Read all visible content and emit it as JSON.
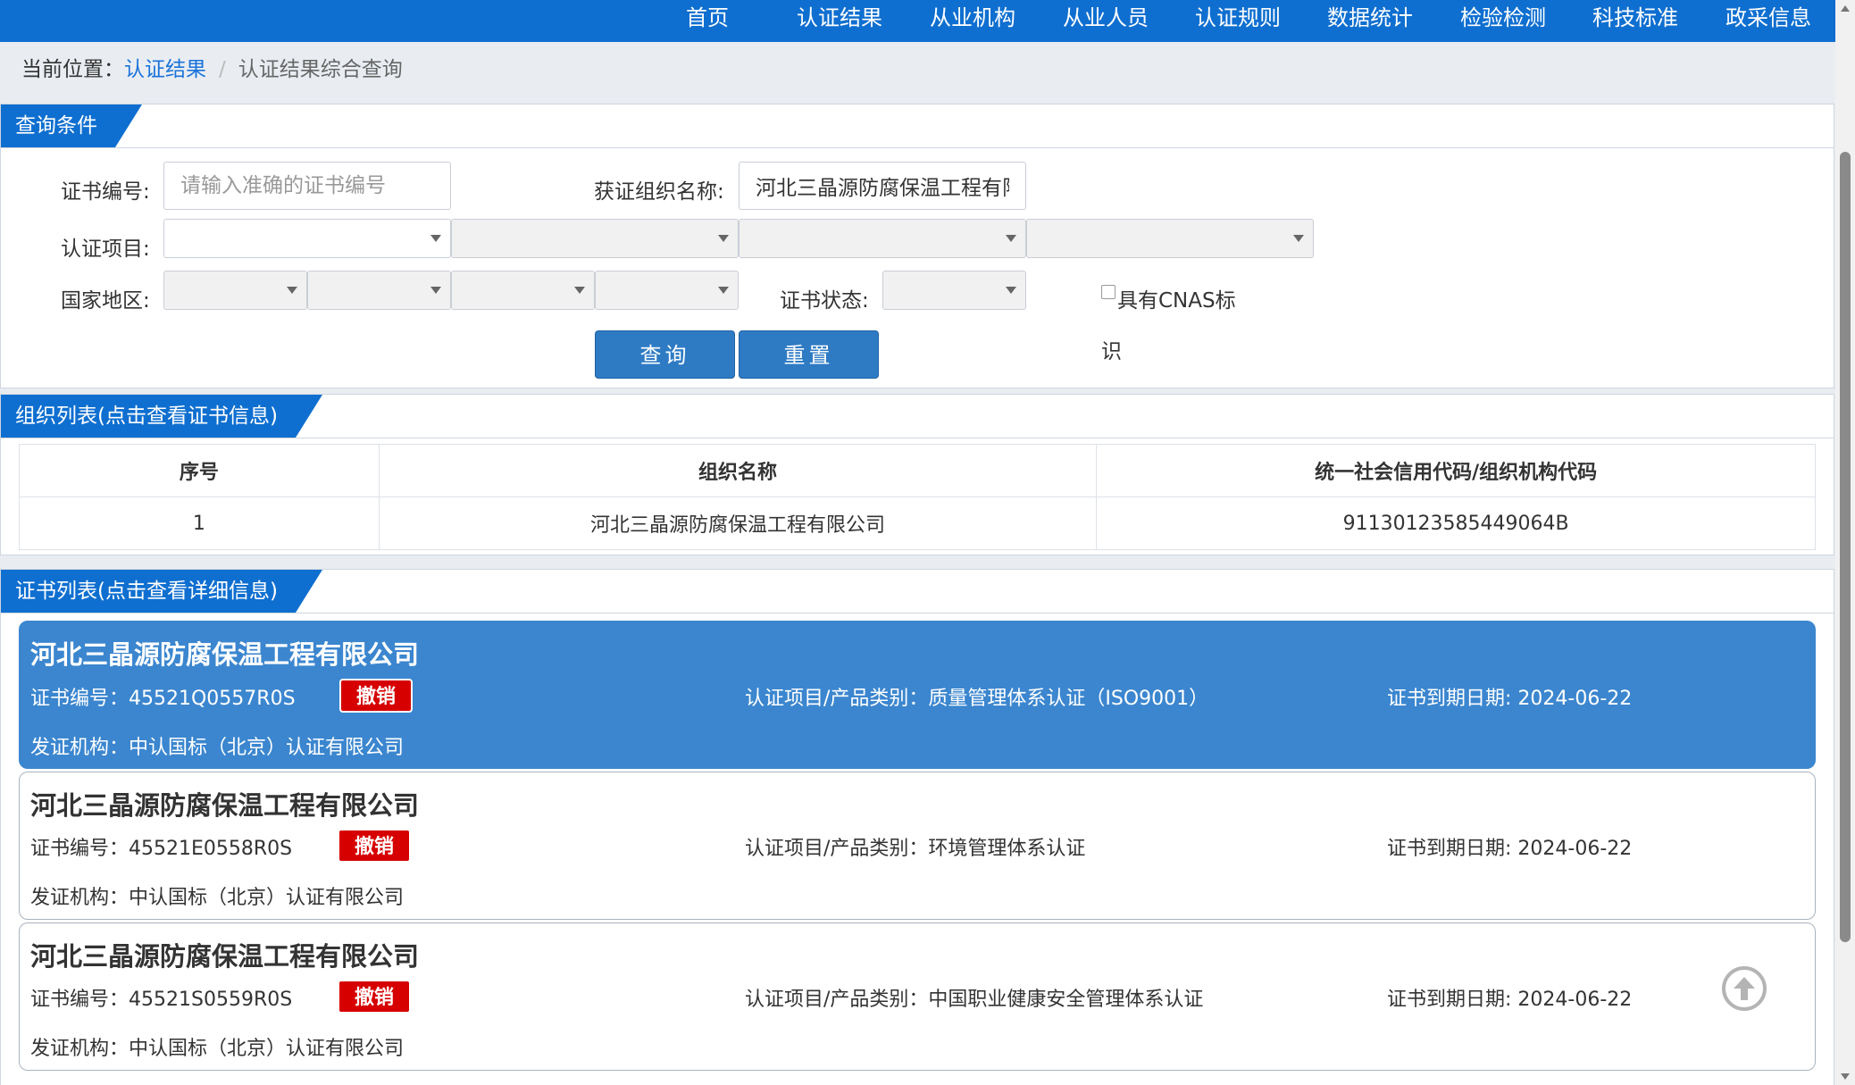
{
  "nav": {
    "items": [
      "首页",
      "认证结果",
      "从业机构",
      "从业人员",
      "认证规则",
      "数据统计",
      "检验检测",
      "科技标准",
      "政采信息"
    ]
  },
  "breadcrumb": {
    "prefix": "当前位置：",
    "link": "认证结果",
    "separator": "/",
    "current": "认证结果综合查询"
  },
  "query": {
    "title": "查询条件",
    "cert_no_label": "证书编号:",
    "cert_no_placeholder": "请输入准确的证书编号",
    "cert_no_value": "",
    "org_name_label": "获证组织名称:",
    "org_name_value": "河北三晶源防腐保温工程有限公司",
    "project_label": "认证项目:",
    "region_label": "国家地区:",
    "status_label": "证书状态:",
    "cnas_label": "具有CNAS标",
    "cnas_label_wrap": "识",
    "search_button": "查询",
    "reset_button": "重置"
  },
  "org_list": {
    "title": "组织列表(点击查看证书信息)",
    "columns": [
      "序号",
      "组织名称",
      "统一社会信用代码/组织机构代码"
    ],
    "rows": [
      {
        "index": "1",
        "name": "河北三晶源防腐保温工程有限公司",
        "code": "91130123585449064B"
      }
    ]
  },
  "cert_list": {
    "title": "证书列表(点击查看详细信息)",
    "cards": [
      {
        "org": "河北三晶源防腐保温工程有限公司",
        "cert_no": "证书编号：45521Q0557R0S",
        "status": "撤销",
        "category": "认证项目/产品类别：质量管理体系认证（ISO9001）",
        "expiry": "证书到期日期: 2024-06-22",
        "issuer": "发证机构：中认国标（北京）认证有限公司"
      },
      {
        "org": "河北三晶源防腐保温工程有限公司",
        "cert_no": "证书编号：45521E0558R0S",
        "status": "撤销",
        "category": "认证项目/产品类别：环境管理体系认证",
        "expiry": "证书到期日期: 2024-06-22",
        "issuer": "发证机构：中认国标（北京）认证有限公司"
      },
      {
        "org": "河北三晶源防腐保温工程有限公司",
        "cert_no": "证书编号：45521S0559R0S",
        "status": "撤销",
        "category": "认证项目/产品类别：中国职业健康安全管理体系认证",
        "expiry": "证书到期日期: 2024-06-22",
        "issuer": "发证机构：中认国标（北京）认证有限公司"
      }
    ]
  },
  "colors": {
    "brand_blue": "#0f6fd0",
    "active_card": "#3b86cf",
    "revoked_badge": "#d60000"
  }
}
